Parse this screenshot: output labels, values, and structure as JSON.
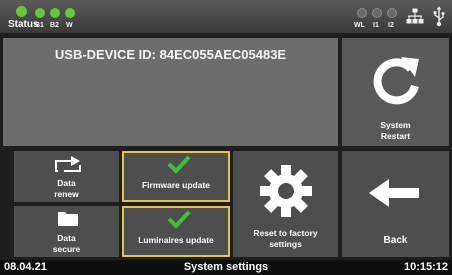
{
  "topbar": {
    "status_label": "Status",
    "indicators": [
      "B1",
      "B2",
      "W"
    ],
    "right_indicators": [
      "WL",
      "I1",
      "I2"
    ],
    "colors": {
      "on": "#69c63a",
      "off": "#6a6a6a"
    }
  },
  "main": {
    "device_id_label": "USB-DEVICE ID: 84EC055AEC05483E"
  },
  "tiles": {
    "system_restart": [
      "System",
      "Restart"
    ],
    "data_renew": [
      "Data",
      "renew"
    ],
    "firmware_update": "Firmware update",
    "reset_factory": [
      "Reset to factory",
      "settings"
    ],
    "back": "Back",
    "data_secure": [
      "Data",
      "secure"
    ],
    "luminaires_update": "Luminaires update"
  },
  "footer": {
    "date": "08.04.21",
    "title": "System settings",
    "time": "10:15:12"
  },
  "accent": {
    "check_green": "#3fbf3c",
    "highlight_border": "#e7c24a"
  }
}
